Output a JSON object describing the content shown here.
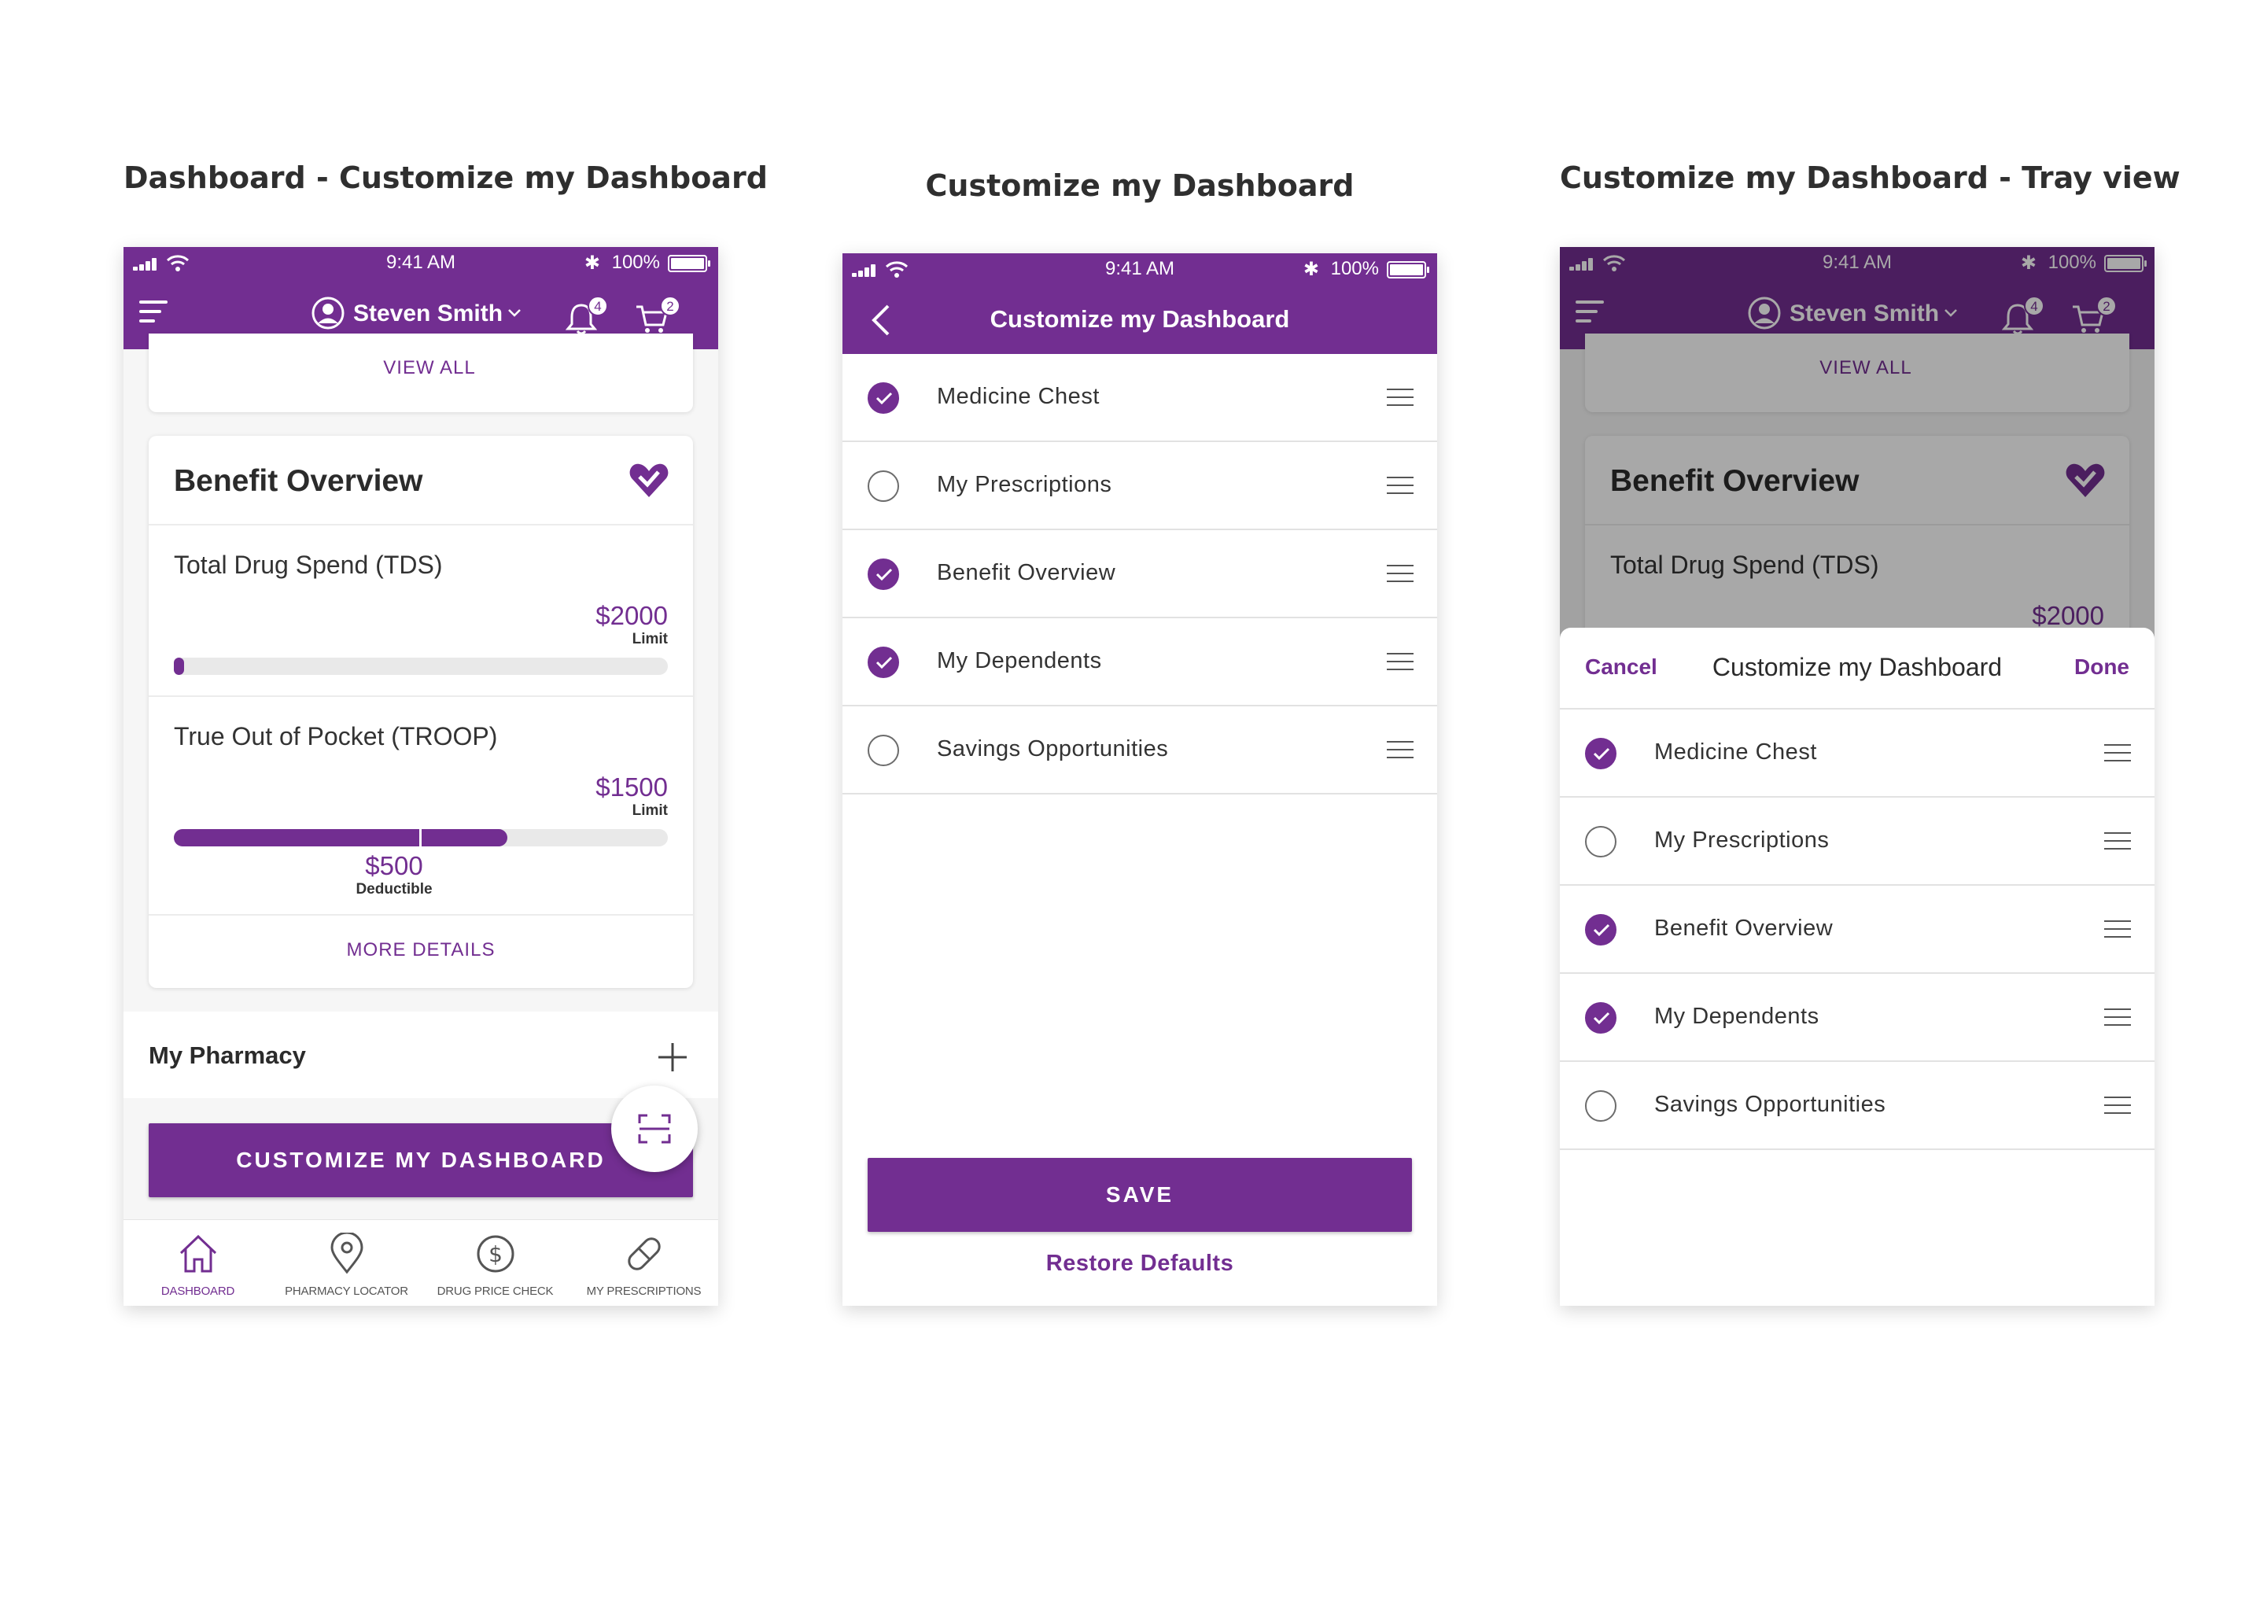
{
  "titles": {
    "panel1": "Dashboard - Customize my Dashboard",
    "panel2": "Customize my Dashboard",
    "panel3": "Customize my Dashboard - Tray view"
  },
  "status": {
    "time": "9:41 AM",
    "battery": "100%"
  },
  "colors": {
    "brand": "#722e91",
    "overlay": "rgba(0,0,0,0.34)"
  },
  "dashboard": {
    "user_name": "Steven Smith",
    "notifications_count": "4",
    "cart_count": "2",
    "view_all": "VIEW ALL",
    "benefit": {
      "title": "Benefit Overview",
      "tds_label": "Total Drug Spend (TDS)",
      "tds_limit_value": "$2000",
      "tds_limit_caption": "Limit",
      "tds_progress": 0.02,
      "troop_label": "True Out of Pocket (TROOP)",
      "troop_limit_value": "$1500",
      "troop_limit_caption": "Limit",
      "troop_progress": 0.675,
      "deductible_value": "$500",
      "deductible_caption": "Deductible",
      "more_details": "MORE DETAILS"
    },
    "pharmacy_title": "My Pharmacy",
    "customize_btn": "CUSTOMIZE MY DASHBOARD",
    "tabs": [
      {
        "label": "DASHBOARD",
        "icon": "home-icon",
        "active": true
      },
      {
        "label": "PHARMACY LOCATOR",
        "icon": "location-pin-icon",
        "active": false
      },
      {
        "label": "DRUG PRICE CHECK",
        "icon": "dollar-icon",
        "active": false
      },
      {
        "label": "MY PRESCRIPTIONS",
        "icon": "pill-icon",
        "active": false
      }
    ]
  },
  "customize": {
    "header_title": "Customize my Dashboard",
    "items": [
      {
        "label": "Medicine Chest",
        "checked": true
      },
      {
        "label": "My Prescriptions",
        "checked": false
      },
      {
        "label": "Benefit Overview",
        "checked": true
      },
      {
        "label": "My Dependents",
        "checked": true
      },
      {
        "label": "Savings Opportunities",
        "checked": false
      }
    ],
    "save_btn": "SAVE",
    "restore_link": "Restore Defaults"
  },
  "tray": {
    "cancel": "Cancel",
    "title": "Customize my Dashboard",
    "done": "Done"
  }
}
